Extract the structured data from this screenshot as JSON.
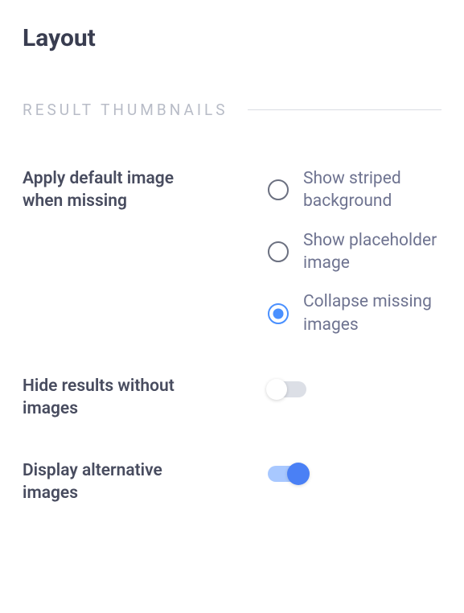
{
  "page_title": "Layout",
  "section": {
    "title": "RESULT THUMBNAILS"
  },
  "settings": {
    "default_image": {
      "label": "Apply default image when missing",
      "options": [
        {
          "label": "Show striped background",
          "selected": false
        },
        {
          "label": "Show placeholder image",
          "selected": false
        },
        {
          "label": "Collapse missing images",
          "selected": true
        }
      ]
    },
    "hide_without_images": {
      "label": "Hide results without images",
      "value": false
    },
    "display_alternative": {
      "label": "Display alternative images",
      "value": true
    }
  }
}
